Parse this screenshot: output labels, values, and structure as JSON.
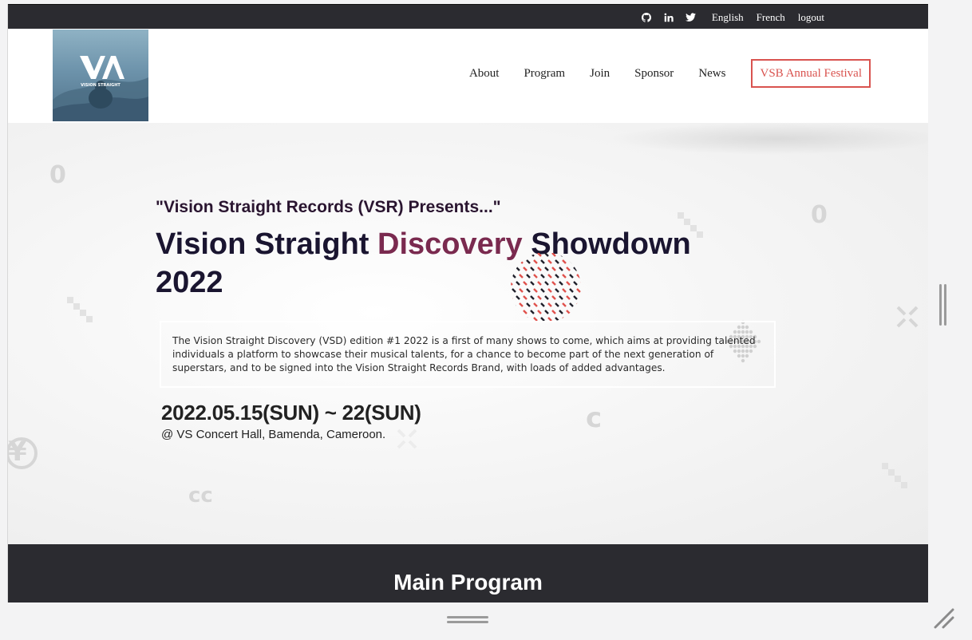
{
  "topbar": {
    "icons": [
      "github-icon",
      "linkedin-icon",
      "twitter-icon"
    ],
    "links": [
      "English",
      "French",
      "logout"
    ]
  },
  "logo": {
    "alt_text": "VISION STRAIGHT"
  },
  "nav": {
    "items": [
      "About",
      "Program",
      "Join",
      "Sponsor",
      "News"
    ],
    "cta": "VSB Annual Festival"
  },
  "hero": {
    "presents": "\"Vision Straight Records (VSR) Presents...\"",
    "title_part1": "Vision Straight ",
    "title_highlight": "Discovery",
    "title_part2": " Showdown 2022",
    "description": "The Vision Straight Discovery (VSD) edition #1 2022 is a first of many shows to come, which aims at providing talented individuals a platform to showcase their musical talents, for a chance to become part of the next generation of superstars, and to be signed into the Vision Straight Records Brand, with loads of added advantages.",
    "date": "2022.05.15(SUN) ~ 22(SUN)",
    "venue": "@ VS Concert Hall, Bamenda, Cameroon."
  },
  "main_program": {
    "title": "Main Program"
  },
  "colors": {
    "dark": "#2b2b30",
    "accent": "#d9534f",
    "title": "#1a1530"
  }
}
